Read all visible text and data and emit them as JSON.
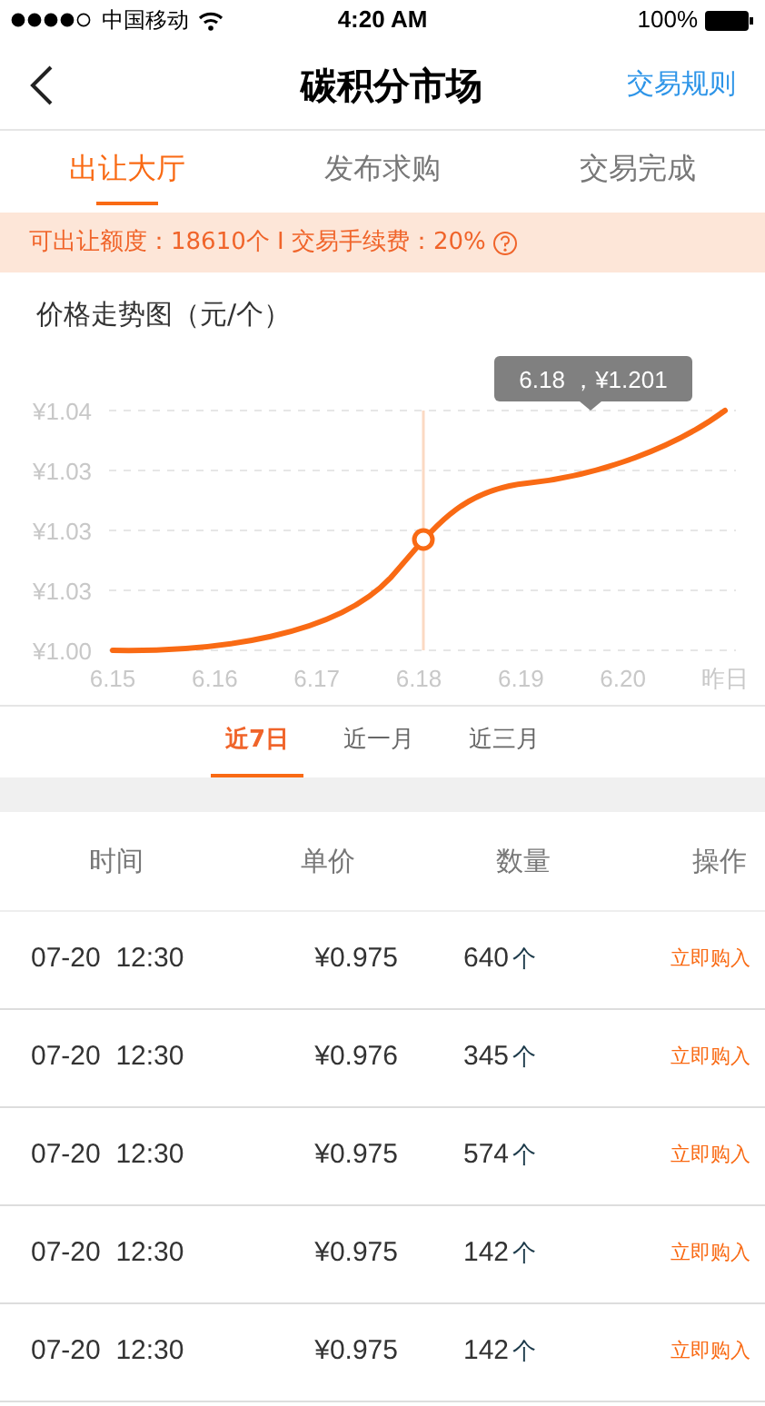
{
  "status_bar": {
    "carrier": "中国移动",
    "time": "4:20 AM",
    "battery": "100%"
  },
  "nav": {
    "title": "碳积分市场",
    "action": "交易规则"
  },
  "tabs": [
    {
      "label": "出让大厅",
      "selected": true
    },
    {
      "label": "发布求购",
      "selected": false
    },
    {
      "label": "交易完成",
      "selected": false
    }
  ],
  "notice": "可出让额度：18610个 I 交易手续费：20%",
  "chart": {
    "title": "价格走势图（元/个）",
    "y_labels": [
      "¥1.04",
      "¥1.03",
      "¥1.03",
      "¥1.03",
      "¥1.00"
    ],
    "x_labels": [
      "6.15",
      "6.16",
      "6.17",
      "6.18",
      "6.19",
      "6.20",
      "昨日"
    ],
    "tooltip": "6.18 ，¥1.201"
  },
  "ranges": [
    {
      "label": "近7日",
      "selected": true
    },
    {
      "label": "近一月",
      "selected": false
    },
    {
      "label": "近三月",
      "selected": false
    }
  ],
  "table": {
    "columns": [
      "时间",
      "单价",
      "数量",
      "操作"
    ],
    "rows": [
      {
        "time": "07-20  12:30",
        "price": "¥0.975",
        "qty": "640",
        "unit": "个",
        "action": "立即购入"
      },
      {
        "time": "07-20  12:30",
        "price": "¥0.976",
        "qty": "345",
        "unit": "个",
        "action": "立即购入"
      },
      {
        "time": "07-20  12:30",
        "price": "¥0.975",
        "qty": "574",
        "unit": "个",
        "action": "立即购入"
      },
      {
        "time": "07-20  12:30",
        "price": "¥0.975",
        "qty": "142",
        "unit": "个",
        "action": "立即购入"
      },
      {
        "time": "07-20  12:30",
        "price": "¥0.975",
        "qty": "142",
        "unit": "个",
        "action": "立即购入"
      }
    ]
  }
}
